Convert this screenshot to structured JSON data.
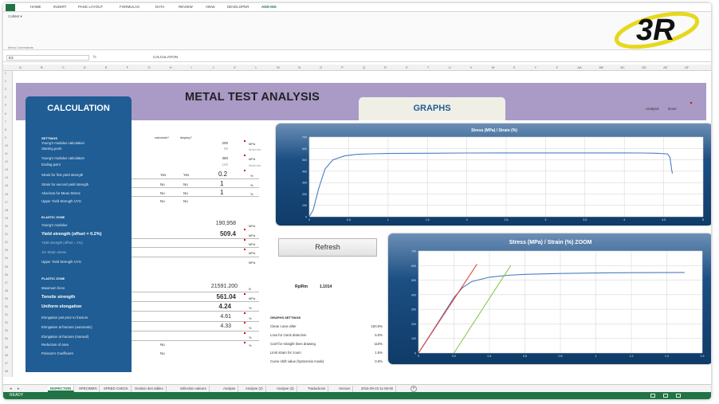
{
  "ribbon": {
    "tabs": [
      "HOME",
      "INSERT",
      "PAGE LAYOUT",
      "FORMULAS",
      "DATA",
      "REVIEW",
      "VIEW",
      "DEVELOPER",
      "ADD-INS"
    ],
    "active_tab": "ADD-INS",
    "group_item": "CalMet ▾",
    "group_label": "Menu Commands"
  },
  "formula_bar": {
    "name_box": "E3",
    "fx": "fx",
    "formula": "CALCULATION"
  },
  "column_headers": [
    "A",
    "B",
    "C",
    "D",
    "E",
    "F",
    "G",
    "H",
    "I",
    "J",
    "K",
    "L",
    "M",
    "N",
    "O",
    "P",
    "Q",
    "R",
    "S",
    "T",
    "U",
    "V",
    "W",
    "X",
    "Y",
    "Z",
    "AA",
    "AB",
    "AC",
    "AD",
    "AE",
    "AF"
  ],
  "row_headers": [
    "1",
    "2",
    "3",
    "4",
    "5",
    "6",
    "7",
    "8",
    "9",
    "10",
    "11",
    "12",
    "13",
    "14",
    "15",
    "16",
    "17",
    "18",
    "19",
    "20",
    "21",
    "22",
    "23",
    "24",
    "25",
    "26",
    "27",
    "28",
    "29",
    "30",
    "31",
    "32",
    "33",
    "34",
    "35",
    "36",
    "37",
    "38"
  ],
  "sheet": {
    "title": "METAL TEST ANALYSIS",
    "tab_calculation": "CALCULATION",
    "tab_graphs": "GRAPHS",
    "analysis_label": "Analysis",
    "analysis_value": "Done"
  },
  "settings": {
    "header": "SETTINGS",
    "col_calculate": "calculate?",
    "col_display": "display?",
    "rows": [
      {
        "label": "Young's modulus calculation",
        "value": "200",
        "unit": "MPa"
      },
      {
        "label": "Starting point",
        "value": "50",
        "unit": "Maximal",
        "grey": true
      },
      {
        "label": "Young's modulus calculation",
        "value": "350",
        "unit": "MPa"
      },
      {
        "label": "Ending point",
        "value": "100",
        "unit": "Maximal",
        "grey": true
      },
      {
        "label": "Strain for first yield strength",
        "calc": "Yes",
        "disp": "Yes",
        "value": "0.2",
        "unit": "%"
      },
      {
        "label": "Strain for second yield strength",
        "calc": "No",
        "disp": "No",
        "value": "1",
        "unit": "%"
      },
      {
        "label": "Abscissa for Mean Stress",
        "calc": "No",
        "disp": "No",
        "value": "1",
        "unit": "%"
      },
      {
        "label": "Upper Yield Strength UYS",
        "calc": "No",
        "disp": "No",
        "value": "",
        "unit": ""
      }
    ]
  },
  "elastic": {
    "header": "ELASTIC ZONE",
    "rows": [
      {
        "label": "Young's modulus",
        "value": "190,958",
        "unit": "MPa",
        "big": false
      },
      {
        "label": "Yield strength (offset = 0.2%)",
        "value": "509.4",
        "unit": "MPa",
        "big": true
      },
      {
        "label": "Yield strength (offset = 1%)",
        "value": "",
        "unit": "MPa",
        "big": false
      },
      {
        "label": "1% Strain stress",
        "value": "",
        "unit": "MPa",
        "big": false
      },
      {
        "label": "Upper Yield Strength UYS",
        "value": "",
        "unit": "MPa",
        "big": false
      }
    ]
  },
  "plastic": {
    "header": "PLASTIC ZONE",
    "rows": [
      {
        "label": "Maximum force",
        "value": "21591.200",
        "unit": "N",
        "big": false
      },
      {
        "label": "Tensile strength",
        "value": "561.04",
        "unit": "MPa",
        "big": true
      },
      {
        "label": "Uniform elongation",
        "value": "4.24",
        "unit": "%",
        "big": true
      },
      {
        "label": "Elongation just prior to fracture",
        "value": "4.61",
        "unit": "%",
        "big": false
      },
      {
        "label": "Elongation at fracture (automatic)",
        "value": "4.33",
        "unit": "%",
        "big": false
      },
      {
        "label": "Elongation at fracture (manual)",
        "value": "",
        "unit": "%",
        "big": false
      },
      {
        "label": "Reduction of area",
        "calc": "No",
        "value": "",
        "unit": "%",
        "big": false
      },
      {
        "label": "Poisson's Coefficient",
        "calc": "No",
        "value": "",
        "unit": "",
        "big": false
      }
    ]
  },
  "refresh_button": "Refresh",
  "ratio": {
    "label": "Rp/Rm",
    "value": "1.1014"
  },
  "graph_settings": {
    "title": "GRAPHS SETTINGS",
    "rows": [
      {
        "label": "Clean curve after",
        "value": "100.0%"
      },
      {
        "label": "Loss for crack detection",
        "value": "5.0%"
      },
      {
        "label": "Coef for straight lines drawing",
        "value": "110%"
      },
      {
        "label": "Limit strain for zoom",
        "value": "1.5%"
      },
      {
        "label": "Curve shift value (hysteresis mode)",
        "value": "0.0%"
      }
    ]
  },
  "chart_data": [
    {
      "type": "line",
      "title": "Stress (MPa) / Strain (%)",
      "xlabel": "",
      "ylabel": "",
      "xlim": [
        0,
        5
      ],
      "ylim": [
        0,
        700
      ],
      "x_ticks": [
        "0",
        "0.5",
        "1",
        "1.5",
        "2",
        "2.5",
        "3",
        "3.5",
        "4",
        "4.5",
        "5"
      ],
      "y_ticks": [
        "0",
        "100",
        "200",
        "300",
        "400",
        "500",
        "600",
        "700"
      ],
      "grid": true,
      "series": [
        {
          "color": "#4a7cc4",
          "x": [
            0,
            0.05,
            0.12,
            0.2,
            0.3,
            0.45,
            0.6,
            0.8,
            1.0,
            1.5,
            2.0,
            2.5,
            3.0,
            3.5,
            4.0,
            4.24,
            4.4,
            4.55,
            4.58,
            4.6,
            4.61
          ],
          "y": [
            0,
            60,
            250,
            420,
            500,
            535,
            548,
            553,
            556,
            558,
            560,
            560.5,
            561,
            561,
            560.5,
            560,
            558,
            552,
            520,
            420,
            380
          ]
        }
      ]
    },
    {
      "type": "line",
      "title": "Stress (MPa) / Strain (%) ZOOM",
      "xlabel": "",
      "ylabel": "",
      "xlim": [
        0,
        1.6
      ],
      "ylim": [
        0,
        700
      ],
      "x_ticks": [
        "0",
        "0.2",
        "0.4",
        "0.6",
        "0.8",
        "1",
        "1.2",
        "1.4",
        "1.6"
      ],
      "y_ticks": [
        "0",
        "100",
        "200",
        "300",
        "400",
        "500",
        "600",
        "700"
      ],
      "grid": true,
      "series": [
        {
          "color": "#4a7cc4",
          "x": [
            0,
            0.1,
            0.2,
            0.25,
            0.3,
            0.4,
            0.5,
            0.6,
            0.8,
            1.0,
            1.2,
            1.4,
            1.5
          ],
          "y": [
            0,
            190,
            380,
            450,
            490,
            520,
            533,
            540,
            546,
            549,
            551,
            552,
            553
          ]
        },
        {
          "color": "#e0403a",
          "x": [
            0,
            0.33
          ],
          "y": [
            0,
            610
          ]
        },
        {
          "color": "#8cc64a",
          "x": [
            0.2,
            0.52
          ],
          "y": [
            0,
            600
          ]
        }
      ]
    }
  ],
  "sheet_tabs": [
    "INSPECTION",
    "SPECIMEN",
    "SPEED CHECK",
    "Gestion des tables",
    "Sélection valeurs",
    "Analyse",
    "Analyse (2)",
    "Analyse (3)",
    "Traductions",
    "Version",
    "2016-09-23 11-05-00"
  ],
  "active_sheet": "INSPECTION",
  "status": {
    "text": "READY"
  }
}
